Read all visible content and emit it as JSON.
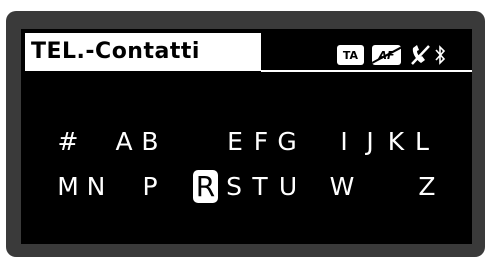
{
  "screen": {
    "title": "TEL.-Contatti",
    "badges": {
      "ta": "TA",
      "af": "AF"
    },
    "icons": [
      "phone-muted-icon",
      "bluetooth-icon"
    ]
  },
  "keyboard": {
    "row1": [
      "#",
      "A",
      "B",
      "E",
      "F",
      "G",
      "I",
      "J",
      "K",
      "L"
    ],
    "row2": [
      "M",
      "N",
      "P",
      "R",
      "S",
      "T",
      "U",
      "W",
      "Z"
    ],
    "selected": "R"
  },
  "colors": {
    "screen_bg": "#000000",
    "text": "#ffffff",
    "highlight": "#ffffff"
  }
}
